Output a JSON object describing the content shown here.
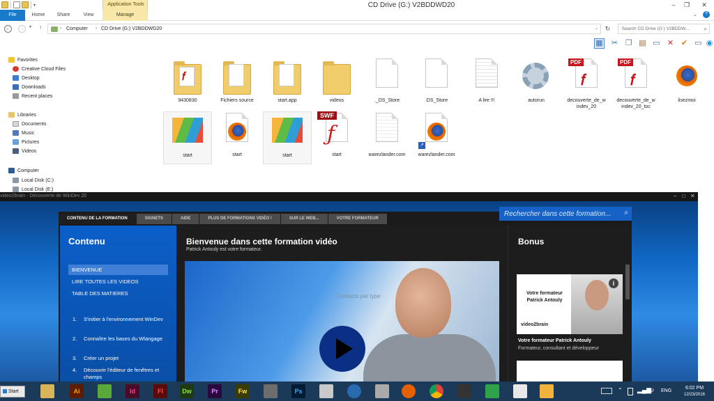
{
  "window": {
    "title": "CD Drive (G:) V2BDDWD20",
    "context_group": "Application Tools"
  },
  "ribbon": {
    "tabs": [
      "File",
      "Home",
      "Share",
      "View",
      "Manage"
    ]
  },
  "address": {
    "crumbs": [
      "Computer",
      "CD Drive (G:) V2BDDWD20"
    ],
    "search_placeholder": "Search CD Drive (G:) V2BDDW..."
  },
  "nav": {
    "favorites": "Favorites",
    "fav_items": [
      "Creative Cloud Files",
      "Desktop",
      "Downloads",
      "Recent places"
    ],
    "libraries": "Libraries",
    "lib_items": [
      "Documents",
      "Music",
      "Pictures",
      "Videos"
    ],
    "computer": "Computer",
    "comp_items": [
      "Local Disk (C:)",
      "Local Disk (E:)"
    ]
  },
  "files": [
    {
      "name": "9430830",
      "type": "folder-pdf"
    },
    {
      "name": "Fichiers source",
      "type": "folder"
    },
    {
      "name": "start.app",
      "type": "folder"
    },
    {
      "name": "videos",
      "type": "folder-empty"
    },
    {
      "name": "._DS_Store",
      "type": "file"
    },
    {
      "name": ".DS_Store",
      "type": "file"
    },
    {
      "name": "A lire !!!",
      "type": "text"
    },
    {
      "name": "autorun",
      "type": "settings"
    },
    {
      "name": "decouverte_de_windev_20",
      "type": "pdf"
    },
    {
      "name": "decouverte_de_windev_20_toc",
      "type": "pdf"
    },
    {
      "name": "lisezmoi",
      "type": "firefox"
    },
    {
      "name": "start",
      "type": "v2b-app"
    },
    {
      "name": "start",
      "type": "firefox"
    },
    {
      "name": "start",
      "type": "v2b-app"
    },
    {
      "name": "start",
      "type": "swf"
    },
    {
      "name": "warezlander.com",
      "type": "file"
    },
    {
      "name": "warezlander.com",
      "type": "firefox-shortcut"
    }
  ],
  "file_label_lines": {
    "decouverte_1": [
      "decouverte_de_w",
      "indev_20"
    ],
    "decouverte_2": [
      "decouverte_de_w",
      "indev_20_toc"
    ]
  },
  "player": {
    "title": "video2brain - Découverte de WinDev 20",
    "tabs": [
      "CONTENU DE LA FORMATION",
      "SIGNETS",
      "AIDE",
      "PLUS DE FORMATIONS VIDÉO !",
      "SUR LE WEB...",
      "VOTRE FORMATEUR"
    ],
    "search_placeholder": "Rechercher dans cette formation...",
    "left_title": "Contenu",
    "menu": [
      "BIENVENUE",
      "LIRE TOUTES LES VIDEOS",
      "TABLE DES MATIERES"
    ],
    "chapters": [
      {
        "num": "1.",
        "title": "S'initier à l'environnement WinDev"
      },
      {
        "num": "2.",
        "title": "Connaître les bases du Wlangage"
      },
      {
        "num": "3.",
        "title": "Créer un projet"
      },
      {
        "num": "4.",
        "title": "Découvrir l'éditeur de fenêtres et champs"
      }
    ],
    "main_title": "Bienvenue dans cette formation vidéo",
    "main_subtitle": "Patrick Antouly est votre formateur.",
    "video_overlay_text": "Contacts par type",
    "bonus_title": "Bonus",
    "bonus_card_text": "Votre formateur Patrick Antouly",
    "bonus_card_brand": "video2brain",
    "bonus_caption": "Votre formateur Patrick Antouly",
    "bonus_caption_sub": "Formateur, consultant et développeur"
  },
  "taskbar": {
    "start": "Start",
    "lang": "ENG",
    "time": "6:02 PM",
    "date": "12/23/2016",
    "apps": [
      {
        "label": "",
        "color": "#d6d6d6"
      },
      {
        "label": "Ai",
        "color": "#5c1d00"
      },
      {
        "label": "Id",
        "color": "#4a0b26"
      },
      {
        "label": "Fl",
        "color": "#5a0b0b"
      },
      {
        "label": "Dw",
        "color": "#1d3a12"
      },
      {
        "label": "Pr",
        "color": "#2a0a3e"
      },
      {
        "label": "Fw",
        "color": "#3b3b05"
      },
      {
        "label": "Ps",
        "color": "#001b34"
      }
    ]
  }
}
